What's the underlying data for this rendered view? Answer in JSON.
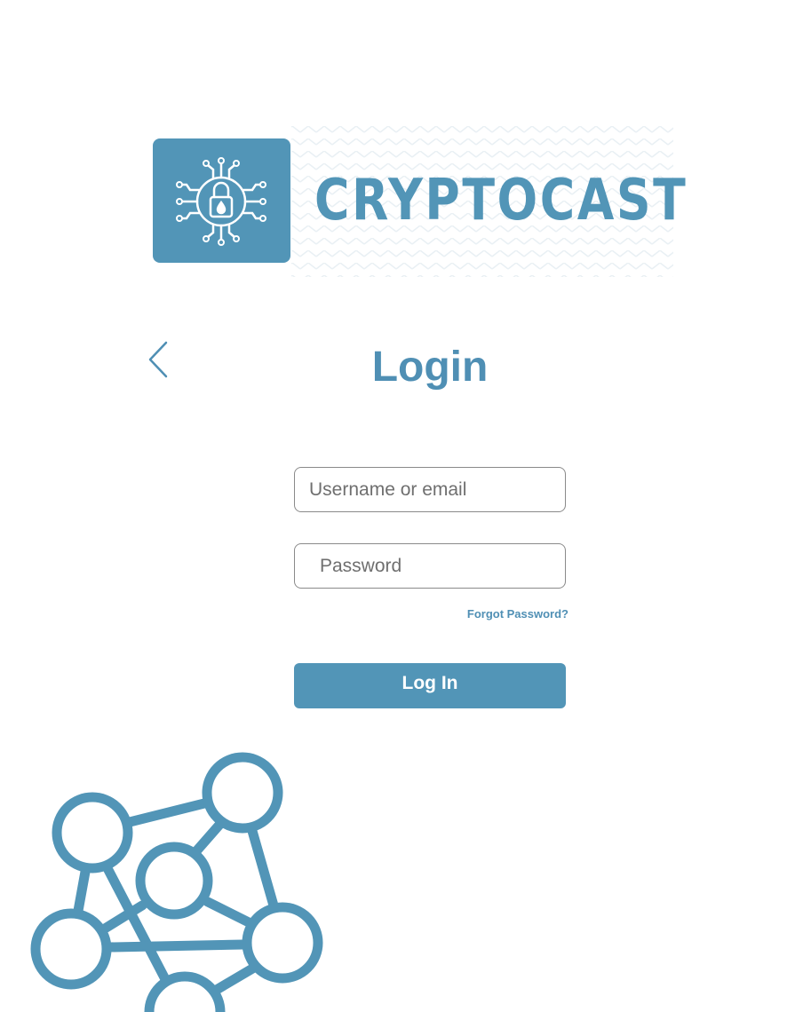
{
  "brand": {
    "name": "CRYPTOCAST",
    "icon": "padlock-circuit-icon",
    "color": "#5295b7"
  },
  "header": {
    "back_icon": "chevron-left-icon",
    "title": "Login"
  },
  "form": {
    "username": {
      "placeholder": "Username or email",
      "value": ""
    },
    "password": {
      "placeholder": "Password",
      "value": ""
    },
    "forgot_label": "Forgot Password?",
    "submit_label": "Log In"
  },
  "decoration": {
    "icon": "network-graph-icon"
  }
}
